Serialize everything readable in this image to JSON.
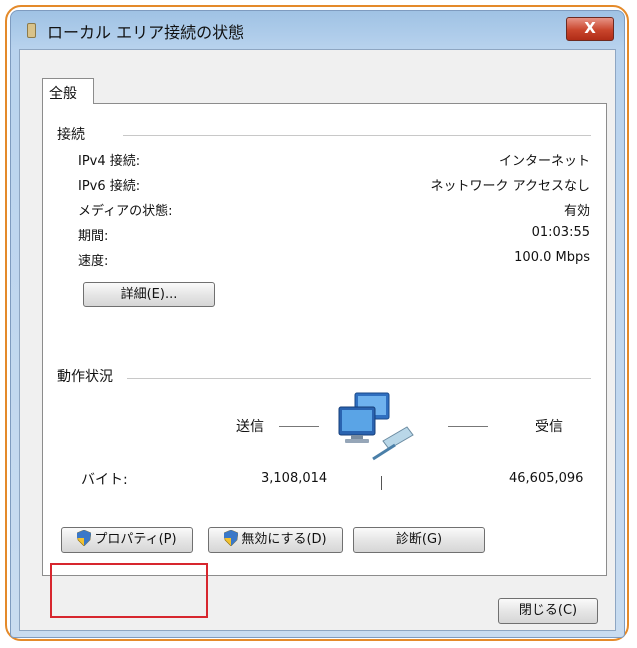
{
  "window": {
    "title": "ローカル エリア接続の状態",
    "close_label": "X"
  },
  "tabs": [
    {
      "label": "全般"
    }
  ],
  "connection": {
    "heading": "接続",
    "rows": [
      {
        "label": "IPv4 接続:",
        "value": "インターネット"
      },
      {
        "label": "IPv6 接続:",
        "value": "ネットワーク アクセスなし"
      },
      {
        "label": "メディアの状態:",
        "value": "有効"
      },
      {
        "label": "期間:",
        "value": "01:03:55"
      },
      {
        "label": "速度:",
        "value": "100.0 Mbps"
      }
    ],
    "details_button": "詳細(E)..."
  },
  "activity": {
    "heading": "動作状況",
    "sent_label": "送信",
    "received_label": "受信",
    "bytes_label": "バイト:",
    "bytes_sent": "3,108,014",
    "bytes_received": "46,605,096",
    "icon": "network-computers-icon"
  },
  "buttons": {
    "properties": "プロパティ(P)",
    "disable": "無効にする(D)",
    "diagnose": "診断(G)",
    "close": "閉じる(C)"
  },
  "colors": {
    "highlight": "#d7262e",
    "frame": "#e48a2a"
  }
}
